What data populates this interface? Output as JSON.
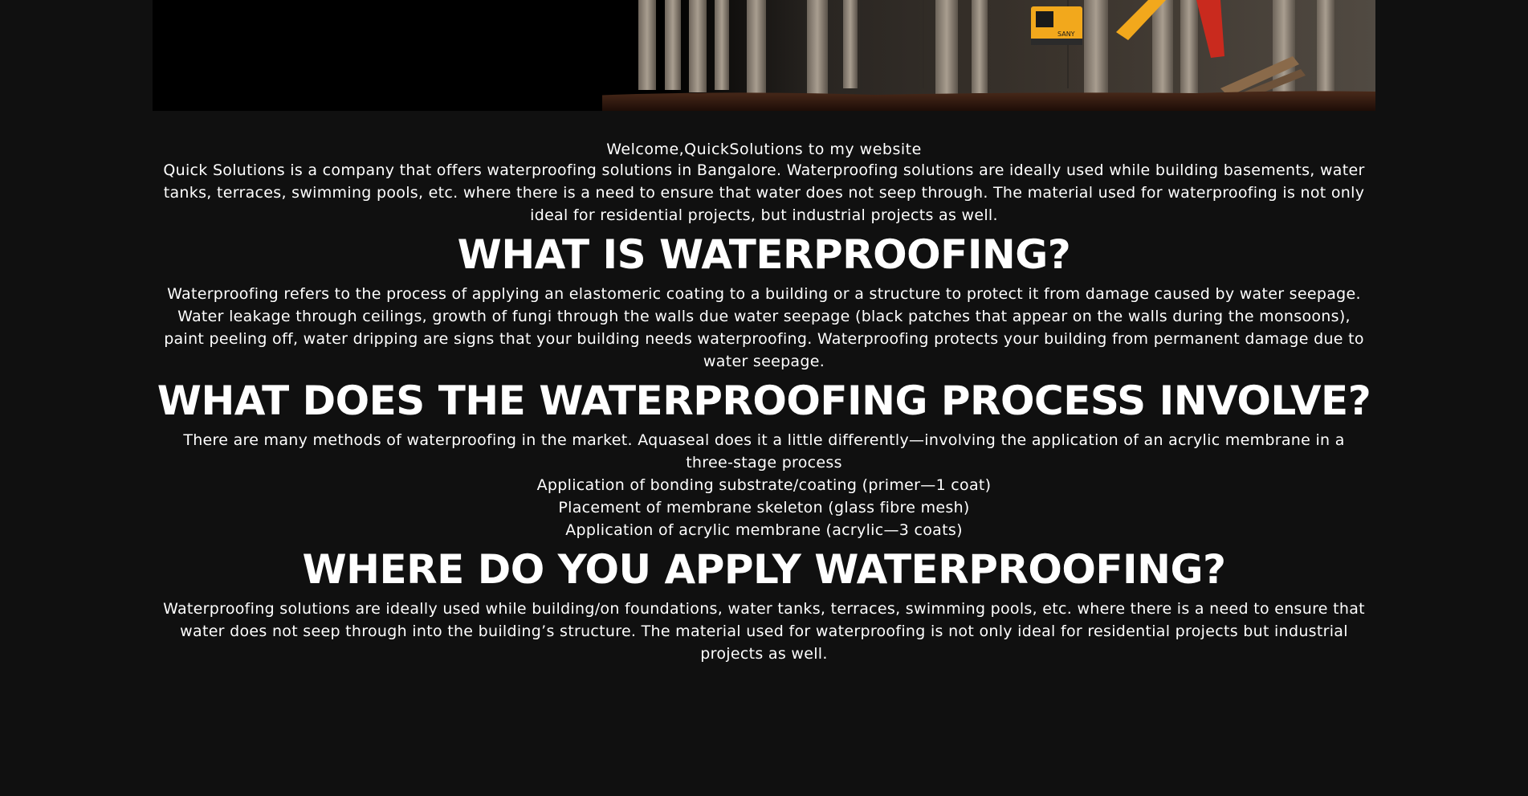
{
  "welcome_text": "Welcome,QuickSolutions to my website",
  "intro": "Quick Solutions is a company that offers waterproofing solutions in Bangalore. Waterproofing solutions are ideally used while building basements, water tanks, terraces, swimming pools, etc. where there is a need to ensure that water does not seep through. The material used for waterproofing is not only ideal for residential projects, but industrial projects as well.",
  "sections": {
    "what": {
      "heading": "WHAT IS WATERPROOFING?",
      "text": "Waterproofing refers to the process of applying an elastomeric coating to a building or a structure to protect it from damage caused by water seepage. Water leakage through ceilings, growth of fungi through the walls due water seepage (black patches that appear on the walls during the monsoons), paint peeling off, water dripping are signs that your building needs waterproofing. Waterproofing protects your building from permanent damage due to water seepage."
    },
    "process": {
      "heading": "WHAT DOES THE WATERPROOFING PROCESS INVOLVE?",
      "text": "There are many methods of waterproofing in the market. Aquaseal does it a little differently—involving the application of an acrylic membrane in a three-stage process",
      "steps": [
        "Application of bonding substrate/coating (primer—1 coat)",
        "Placement of membrane skeleton (glass fibre mesh)",
        "Application of acrylic membrane (acrylic—3 coats)"
      ]
    },
    "where": {
      "heading": "WHERE DO YOU APPLY WATERPROOFING?",
      "text": "Waterproofing solutions are ideally used while building/on foundations, water tanks, terraces, swimming pools, etc. where there is a need to ensure that water does not seep through into the building’s structure. The material used for waterproofing is not only ideal for residential projects but industrial projects as well."
    }
  },
  "hero": {
    "machine_label": "SANY",
    "colors": {
      "excavator": "#f2a81c",
      "ground": "#3a1a10",
      "pillar": "#8f8478"
    }
  }
}
